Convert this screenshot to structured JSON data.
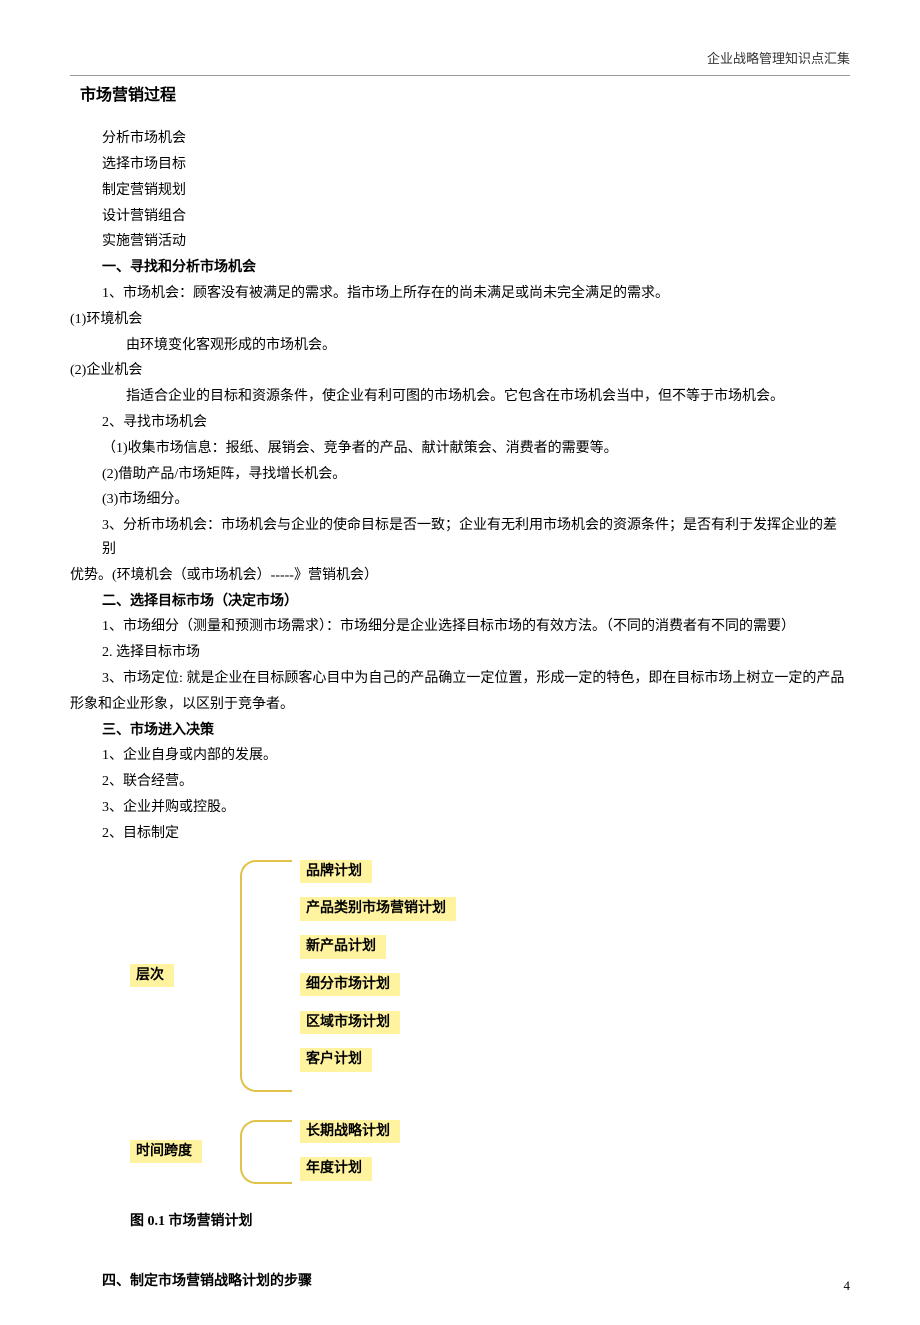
{
  "header": {
    "right": "企业战略管理知识点汇集"
  },
  "title": "市场营销过程",
  "intro_lines": [
    "分析市场机会",
    "选择市场目标",
    "制定营销规划",
    "设计营销组合",
    "实施营销活动"
  ],
  "s1": {
    "head": "一、寻找和分析市场机会",
    "p1": "1、市场机会：顾客没有被满足的需求。指市场上所存在的尚未满足或尚未完全满足的需求。",
    "env_t": "(1)环境机会",
    "env_b": "由环境变化客观形成的市场机会。",
    "ent_t": "(2)企业机会",
    "ent_b": "指适合企业的目标和资源条件，使企业有利可图的市场机会。它包含在市场机会当中，但不等于市场机会。",
    "p2": "2、寻找市场机会",
    "p2a": "（1)收集市场信息：报纸、展销会、竞争者的产品、献计献策会、消费者的需要等。",
    "p2b": "(2)借助产品/市场矩阵，寻找增长机会。",
    "p2c": "(3)市场细分。",
    "p3a": "3、分析市场机会：市场机会与企业的使命目标是否一致；企业有无利用市场机会的资源条件；是否有利于发挥企业的差别",
    "p3b": "优势。(环境机会（或市场机会）-----》营销机会）"
  },
  "s2": {
    "head": "二、选择目标市场（决定市场）",
    "p1": "1、市场细分（测量和预测市场需求）：市场细分是企业选择目标市场的有效方法。（不同的消费者有不同的需要）",
    "p2": "2. 选择目标市场",
    "p3a": "3、市场定位: 就是企业在目标顾客心目中为自己的产品确立一定位置，形成一定的特色，即在目标市场上树立一定的产品",
    "p3b": "形象和企业形象，以区别于竞争者。"
  },
  "s3": {
    "head": "三、市场进入决策",
    "p1": "1、企业自身或内部的发展。",
    "p2": "2、联合经营。",
    "p3": "3、企业并购或控股。",
    "p4": "2、目标制定"
  },
  "diagram": {
    "g1_label": "层次",
    "g1_items": [
      "品牌计划",
      "产品类别市场营销计划",
      "新产品计划",
      "细分市场计划",
      "区域市场计划",
      "客户计划"
    ],
    "g2_label": "时间跨度",
    "g2_items": [
      "长期战略计划",
      "年度计划"
    ],
    "caption": "图 0.1  市场营销计划"
  },
  "s4": {
    "head": "四、制定市场营销战略计划的步骤"
  },
  "page_num": "4"
}
